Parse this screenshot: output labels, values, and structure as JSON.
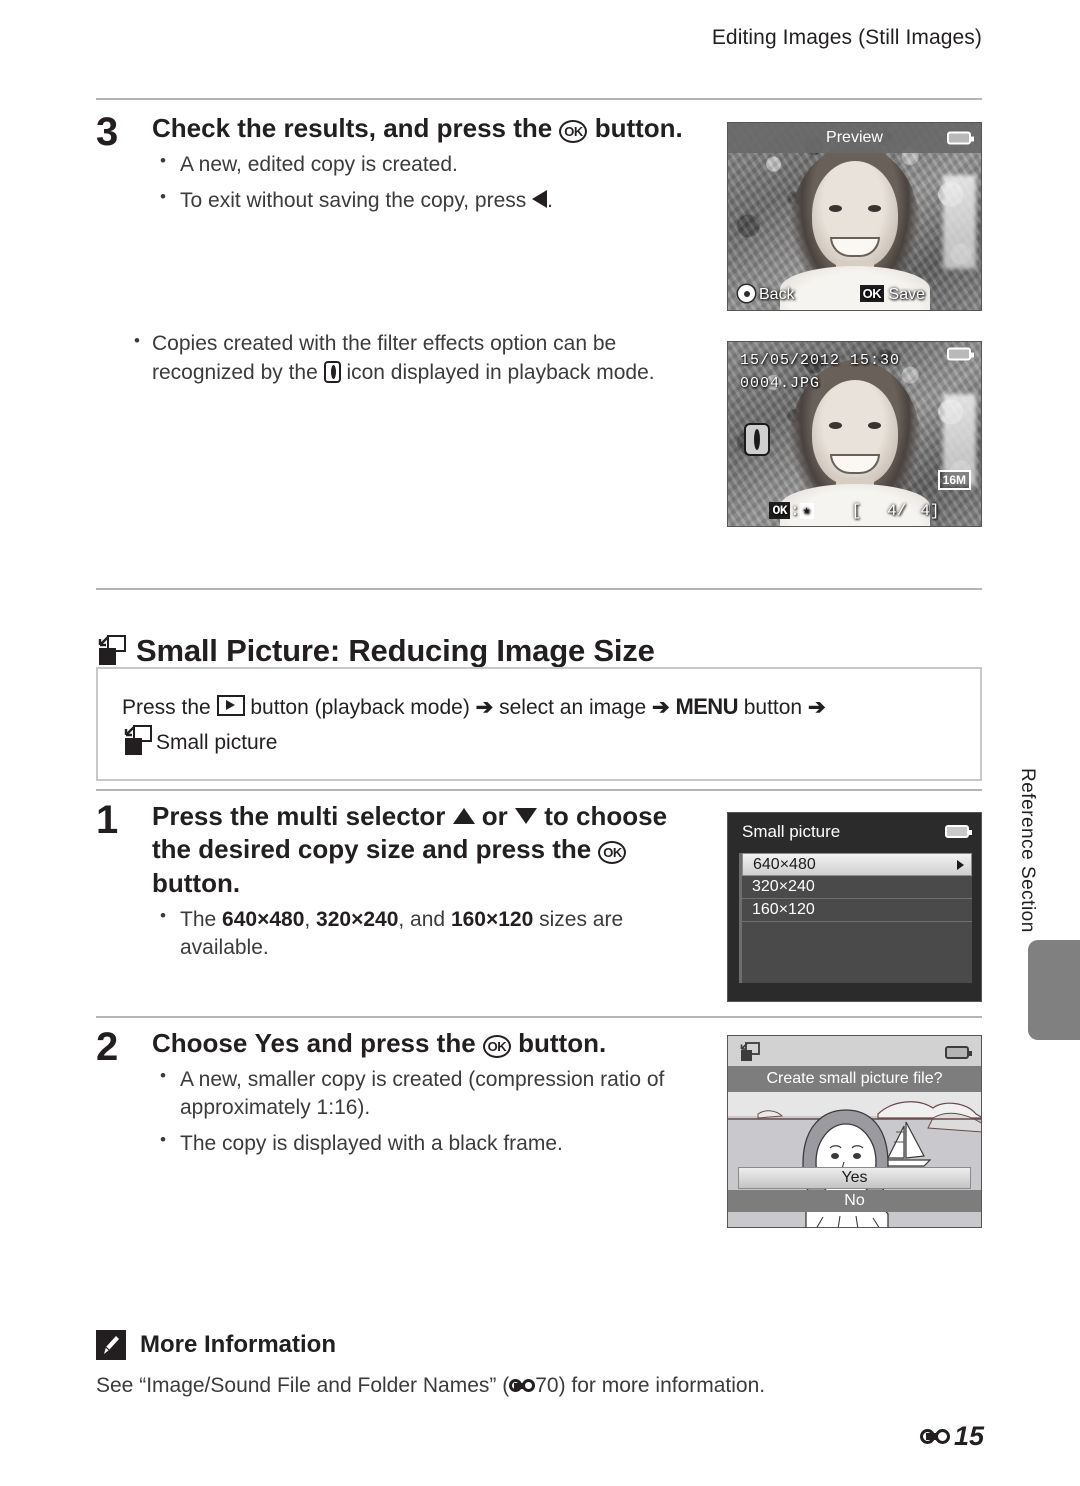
{
  "header": {
    "running_head": "Editing Images (Still Images)"
  },
  "steps": {
    "step3": {
      "number": "3",
      "title_pre": "Check the results, and press the ",
      "ok_label": "OK",
      "title_post": " button.",
      "bullets": [
        "A new, edited copy is created.",
        "To exit without saving the copy, press "
      ]
    },
    "note_filter": {
      "line1": "Copies created with the filter effects option can be",
      "line2_pre": "recognized by the ",
      "line2_post": " icon displayed in playback mode."
    },
    "step1": {
      "number": "1",
      "title_a": "Press the multi selector ",
      "title_or": " or ",
      "title_b": " to choose the desired copy size and press the ",
      "ok_label": "OK",
      "title_c": " button.",
      "bullet_pre": "The ",
      "size1": "640×480",
      "sep1": ", ",
      "size2": "320×240",
      "sep2": ", and ",
      "size3": "160×120",
      "bullet_post": " sizes are available."
    },
    "step2": {
      "number": "2",
      "title_pre": "Choose ",
      "yes": "Yes",
      "title_mid": " and press the ",
      "ok_label": "OK",
      "title_post": " button.",
      "bullets": [
        "A new, smaller copy is created (compression ratio of approximately 1:16).",
        "The copy is displayed with a black frame."
      ]
    }
  },
  "section": {
    "heading": "Small Picture: Reducing Image Size",
    "howto_pre": "Press the ",
    "howto_mid1": " button (playback mode) ",
    "howto_select": " select an image ",
    "howto_menu": "MENU",
    "howto_button": " button ",
    "howto_last": "Small picture",
    "arrow": "➔"
  },
  "more_info": {
    "title": "More Information",
    "body_pre": "See “Image/Sound File and Folder Names” (",
    "ref_num": "70",
    "body_post": ") for more information."
  },
  "side_tab": {
    "label": "Reference Section"
  },
  "folio": {
    "page": "15"
  },
  "screens": {
    "preview": {
      "title": "Preview",
      "back_label": "Back",
      "ok_label": "OK",
      "save_label": "Save"
    },
    "playback": {
      "date": "15/05/2012  15:30",
      "filename": "0004.JPG",
      "image_size": "16M",
      "ok_label": "OK",
      "separator": ":",
      "star": "★",
      "counter_open": "[",
      "counter": "4/",
      "counter_total": "4",
      "counter_close": "]"
    },
    "small_picture_menu": {
      "title": "Small picture",
      "items": [
        {
          "label": "640×480",
          "selected": true
        },
        {
          "label": "320×240",
          "selected": false
        },
        {
          "label": "160×120",
          "selected": false
        }
      ]
    },
    "confirm": {
      "question": "Create small picture file?",
      "yes": "Yes",
      "no": "No"
    }
  },
  "colors": {
    "text": "#231f20",
    "rule": "#b4b4b4",
    "box_border": "#c8c8c8",
    "tab_gray": "#808080",
    "osd_gray": "#696969"
  }
}
